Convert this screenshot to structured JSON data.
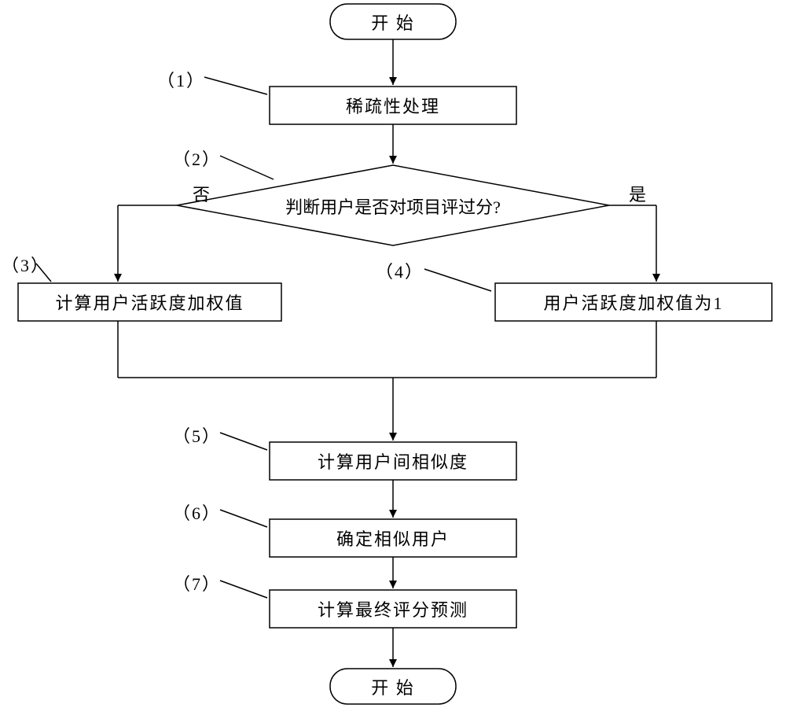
{
  "start": "开 始",
  "end": "开 始",
  "step1": {
    "num": "（1）",
    "text": "稀疏性处理"
  },
  "step2": {
    "num": "（2）",
    "text": "判断用户是否对项目评过分?"
  },
  "step3": {
    "num": "（3）",
    "text": "计算用户活跃度加权值"
  },
  "step4": {
    "num": "（4）",
    "text": "用户活跃度加权值为1"
  },
  "step5": {
    "num": "（5）",
    "text": "计算用户间相似度"
  },
  "step6": {
    "num": "（6）",
    "text": "确定相似用户"
  },
  "step7": {
    "num": "（7）",
    "text": "计算最终评分预测"
  },
  "no": "否",
  "yes": "是"
}
